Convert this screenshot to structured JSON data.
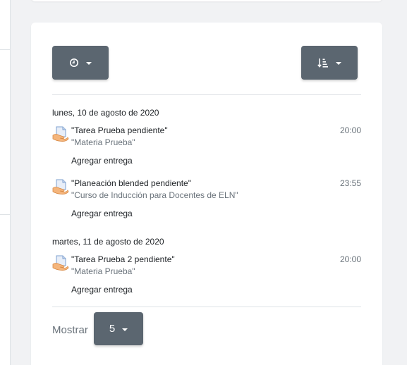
{
  "filters": {
    "time_icon": "clock-icon",
    "sort_icon": "sort-icon"
  },
  "timeline": [
    {
      "date": "lunes, 10 de agosto de 2020",
      "items": [
        {
          "title": "\"Tarea Prueba pendiente\"",
          "course": "\"Materia Prueba\"",
          "time": "20:00",
          "action": "Agregar entrega"
        },
        {
          "title": "\"Planeación blended pendiente\"",
          "course": "\"Curso de Inducción para Docentes de ELN\"",
          "time": "23:55",
          "action": "Agregar entrega"
        }
      ]
    },
    {
      "date": "martes, 11 de agosto de 2020",
      "items": [
        {
          "title": "\"Tarea Prueba 2 pendiente\"",
          "course": "\"Materia Prueba\"",
          "time": "20:00",
          "action": "Agregar entrega"
        }
      ]
    }
  ],
  "pagination": {
    "show_label": "Mostrar",
    "page_size": "5"
  },
  "colors": {
    "button_bg": "#5b6670",
    "muted_text": "#6a737b",
    "background": "#f1f2f4"
  }
}
